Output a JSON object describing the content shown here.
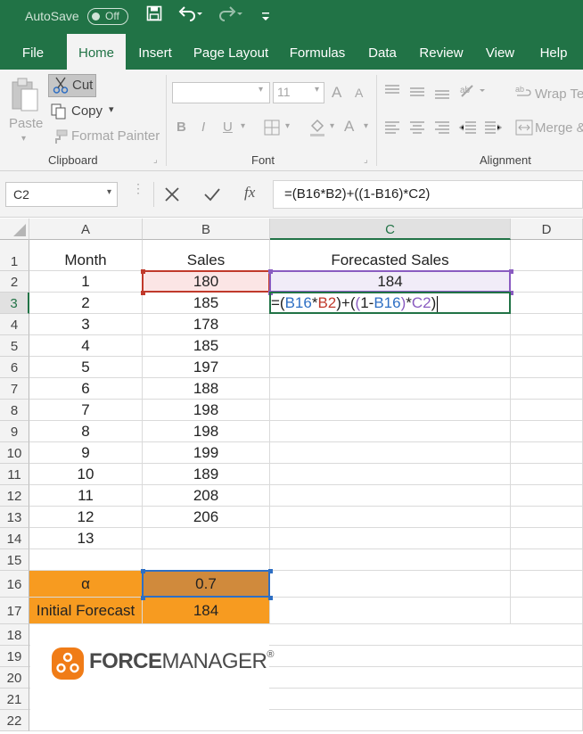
{
  "titlebar": {
    "autosave_label": "AutoSave",
    "autosave_state": "Off"
  },
  "tabs": [
    "File",
    "Home",
    "Insert",
    "Page Layout",
    "Formulas",
    "Data",
    "Review",
    "View",
    "Help"
  ],
  "active_tab": "Home",
  "ribbon": {
    "clipboard": {
      "paste": "Paste",
      "cut": "Cut",
      "copy": "Copy",
      "format_painter": "Format Painter",
      "group_label": "Clipboard"
    },
    "font": {
      "size": "11",
      "bold": "B",
      "italic": "I",
      "underline": "U",
      "font_color": "A",
      "grow": "A",
      "shrink": "A",
      "group_label": "Font"
    },
    "alignment": {
      "wrap_text": "Wrap Te",
      "merge": "Merge &",
      "group_label": "Alignment"
    }
  },
  "formula_bar": {
    "name_box": "C2",
    "fx": "fx",
    "formula": "=(B16*B2)+((1-B16)*C2)"
  },
  "columns": [
    {
      "label": "",
      "width": 33
    },
    {
      "label": "A",
      "width": 127
    },
    {
      "label": "B",
      "width": 143
    },
    {
      "label": "C",
      "width": 270
    },
    {
      "label": "D",
      "width": 81
    }
  ],
  "rows": [
    "1",
    "2",
    "3",
    "4",
    "5",
    "6",
    "7",
    "8",
    "9",
    "10",
    "11",
    "12",
    "13",
    "14",
    "15",
    "16",
    "17",
    "18",
    "19",
    "20",
    "21",
    "22"
  ],
  "cells": {
    "headers": {
      "A1": "Month",
      "B1": "Sales",
      "C1": "Forecasted Sales"
    },
    "months": [
      "1",
      "2",
      "3",
      "4",
      "5",
      "6",
      "7",
      "8",
      "9",
      "10",
      "11",
      "12",
      "13"
    ],
    "sales": [
      "180",
      "185",
      "178",
      "185",
      "197",
      "188",
      "198",
      "198",
      "199",
      "189",
      "208",
      "206"
    ],
    "C2": "184",
    "A16": "α",
    "B16": "0.7",
    "A17": "Initial Forecast",
    "B17": "184"
  },
  "edit_formula": [
    {
      "t": "=(",
      "c": ""
    },
    {
      "t": "B16",
      "c": "blue"
    },
    {
      "t": "*",
      "c": ""
    },
    {
      "t": "B2",
      "c": "red"
    },
    {
      "t": ")+(",
      "c": ""
    },
    {
      "t": "(",
      "c": "purple"
    },
    {
      "t": "1-",
      "c": ""
    },
    {
      "t": "B16",
      "c": "blue"
    },
    {
      "t": ")",
      "c": "purple"
    },
    {
      "t": "*",
      "c": ""
    },
    {
      "t": "C2",
      "c": "purple"
    },
    {
      "t": ")",
      "c": ""
    }
  ],
  "logo": {
    "brand_bold": "FORCE",
    "brand_light": "MANAGER",
    "registered": "®"
  },
  "colors": {
    "excel_green": "#217346",
    "orange": "#f79b20",
    "alpha_fill": "#d08a3c",
    "ref_blue": "#2e6fc4",
    "ref_red": "#c0392b",
    "ref_purple": "#8a5cc1"
  }
}
